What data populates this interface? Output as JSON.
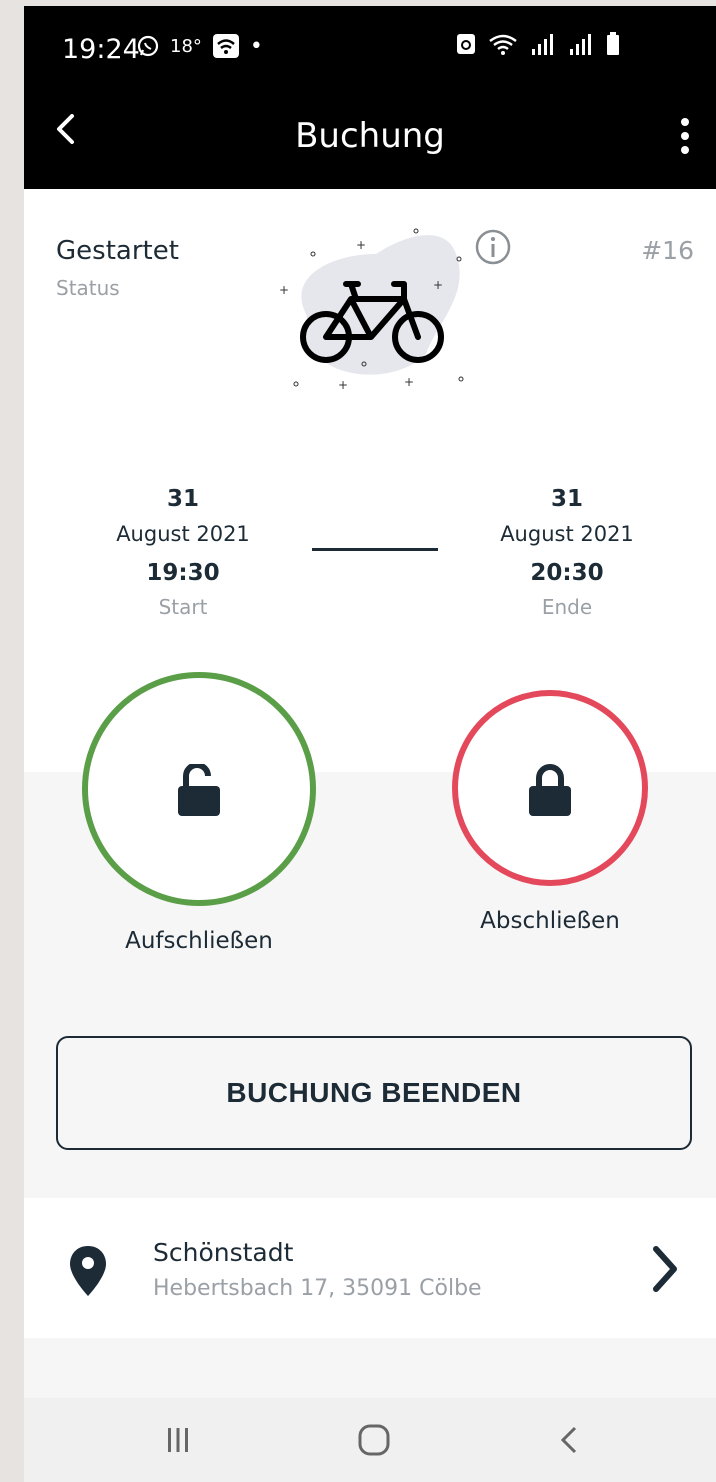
{
  "status_bar": {
    "time": "19:24",
    "temperature": "18°"
  },
  "app_bar": {
    "title": "Buchung"
  },
  "booking": {
    "status_value": "Gestartet",
    "status_label": "Status",
    "id": "#16",
    "start": {
      "day": "31",
      "month_year": "August 2021",
      "time": "19:30",
      "label": "Start"
    },
    "end": {
      "day": "31",
      "month_year": "August 2021",
      "time": "20:30",
      "label": "Ende"
    }
  },
  "actions": {
    "unlock_label": "Aufschließen",
    "lock_label": "Abschließen",
    "end_booking_label": "BUCHUNG BEENDEN"
  },
  "location": {
    "name": "Schönstadt",
    "address": "Hebertsbach 17, 35091 Cölbe"
  },
  "colors": {
    "unlock": "#5a9e47",
    "lock": "#e4485b",
    "text": "#1c2b36",
    "muted": "#9aa0a6"
  },
  "icons": [
    "back-arrow-icon",
    "more-vert-icon",
    "info-icon",
    "bike-icon",
    "lock-open-icon",
    "lock-icon",
    "location-pin-icon",
    "chevron-right-icon"
  ]
}
